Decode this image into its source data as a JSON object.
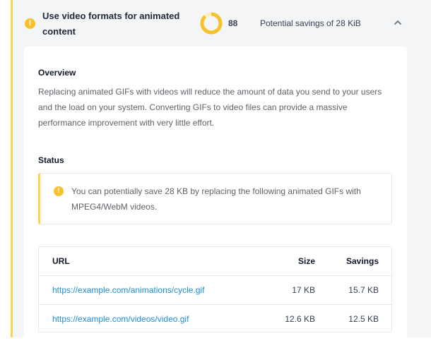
{
  "audit": {
    "title": "Use video formats for animated content",
    "score": "88",
    "score_fraction": 0.88,
    "savings_text": "Potential savings of 28 KiB",
    "accent_color": "#fcd34d",
    "warning_color": "#f6c12a",
    "status_icon": "warning-icon",
    "toggle_icon": "chevron-up-icon"
  },
  "overview": {
    "title": "Overview",
    "text": "Replacing animated GIFs with videos will reduce the amount of data you send to your users and the load on your system. Converting GIFs to video files can provide a massive performance improvement with very little effort."
  },
  "status": {
    "title": "Status",
    "message": "You can potentially save 28 KB by replacing the following animated GIFs with MPEG4/WebM videos."
  },
  "table": {
    "headers": {
      "url": "URL",
      "size": "Size",
      "savings": "Savings"
    },
    "rows": [
      {
        "url": "https://example.com/animations/cycle.gif",
        "size": "17 KB",
        "savings": "15.7 KB"
      },
      {
        "url": "https://example.com/videos/video.gif",
        "size": "12.6 KB",
        "savings": "12.5 KB"
      }
    ]
  }
}
